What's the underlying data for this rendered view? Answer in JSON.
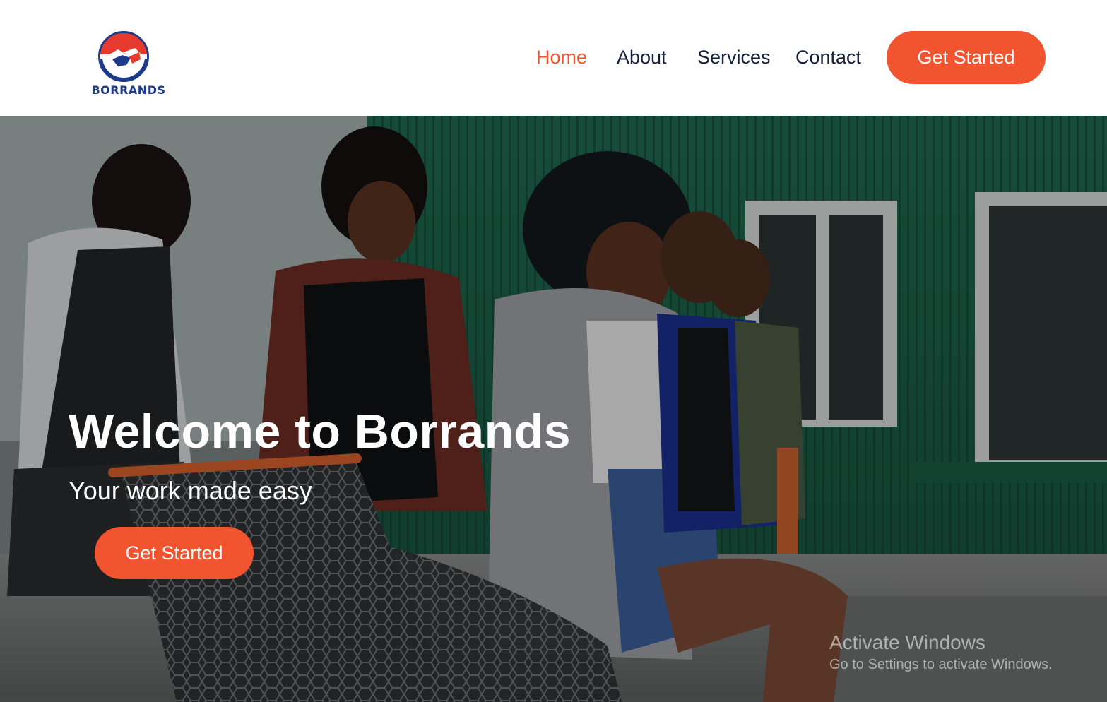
{
  "brand": {
    "name": "BORRANDS",
    "colors": {
      "red": "#e63a2e",
      "navy": "#1e3a8a"
    }
  },
  "nav": {
    "items": [
      {
        "label": "Home",
        "active": true
      },
      {
        "label": "About",
        "active": false
      },
      {
        "label": "Services",
        "active": false
      },
      {
        "label": "Contact",
        "active": false
      }
    ],
    "cta_label": "Get Started"
  },
  "hero": {
    "title": "Welcome to Borrands",
    "subtitle": "Your work made easy",
    "cta_label": "Get Started"
  },
  "watermark": {
    "title": "Activate Windows",
    "subtitle": "Go to Settings to activate Windows."
  },
  "colors": {
    "accent": "#f25430",
    "nav_text": "#14213d",
    "header_bg": "#ffffff"
  }
}
